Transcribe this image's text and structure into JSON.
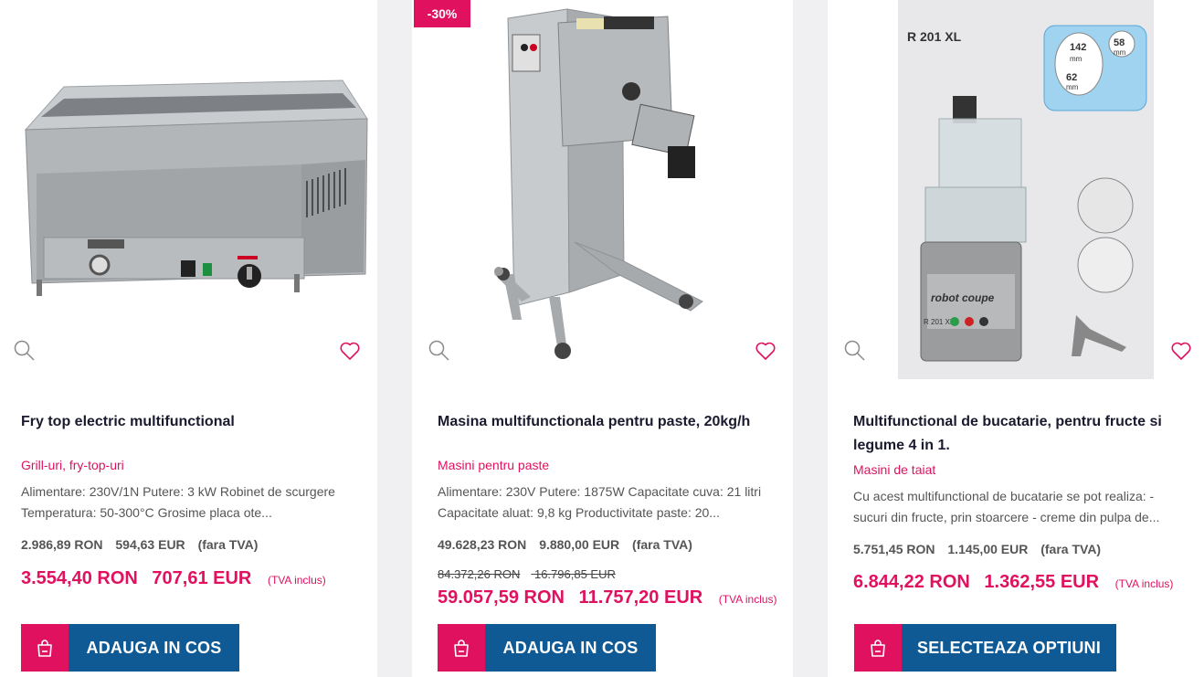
{
  "products": [
    {
      "title": "Fry top electric multifunctional",
      "category": "Grill-uri, fry-top-uri",
      "description": "Alimentare: 230V/1N Putere: 3 kW Robinet de scurgere Temperatura: 50-300°C Grosime placa ote...",
      "price_net_ron": "2.986,89 RON",
      "price_net_eur": "594,63 EUR",
      "net_note": "(fara TVA)",
      "price_gross_ron": "3.554,40 RON",
      "price_gross_eur": "707,61 EUR",
      "gross_note": "(TVA inclus)",
      "button": "ADAUGA IN COS",
      "image_icon": "fry-top-image"
    },
    {
      "badge": "-30%",
      "title": "Masina multifunctionala pentru paste, 20kg/h",
      "category": "Masini pentru paste",
      "description": "Alimentare: 230V Putere: 1875W Capacitate cuva: 21 litri Capacitate aluat: 9,8 kg Productivitate paste: 20...",
      "price_net_ron": "49.628,23 RON",
      "price_net_eur": "9.880,00 EUR",
      "net_note": "(fara TVA)",
      "old_price_ron": "84.372,26 RON",
      "old_price_eur": "16.796,85 EUR",
      "price_gross_ron": "59.057,59 RON",
      "price_gross_eur": "11.757,20 EUR",
      "gross_note": "(TVA inclus)",
      "button": "ADAUGA IN COS",
      "image_icon": "pasta-machine-image"
    },
    {
      "title": "Multifunctional de bucatarie, pentru fructe si legume 4 in 1.",
      "category": "Masini de taiat",
      "description": "Cu acest multifunctional de bucatarie se pot realiza: - sucuri din fructe, prin stoarcere - creme din pulpa de...",
      "price_net_ron": "5.751,45 RON",
      "price_net_eur": "1.145,00 EUR",
      "net_note": "(fara TVA)",
      "price_gross_ron": "6.844,22 RON",
      "price_gross_eur": "1.362,55 EUR",
      "gross_note": "(TVA inclus)",
      "button": "SELECTEAZA OPTIUNI",
      "image_icon": "food-processor-image",
      "image_text": {
        "model": "R 201 XL",
        "brand": "robot coupe",
        "dim1": "142",
        "dim1_unit": "mm",
        "dim2": "58",
        "dim2_unit": "mm",
        "dim3": "62",
        "dim3_unit": "mm",
        "panel": "R 201 XL"
      }
    }
  ],
  "colors": {
    "accent": "#e0115f",
    "button_blue": "#0f5a95",
    "page_bg": "#f0f0f2"
  },
  "icons": [
    "search-icon",
    "heart-icon",
    "shopping-bag-icon"
  ]
}
